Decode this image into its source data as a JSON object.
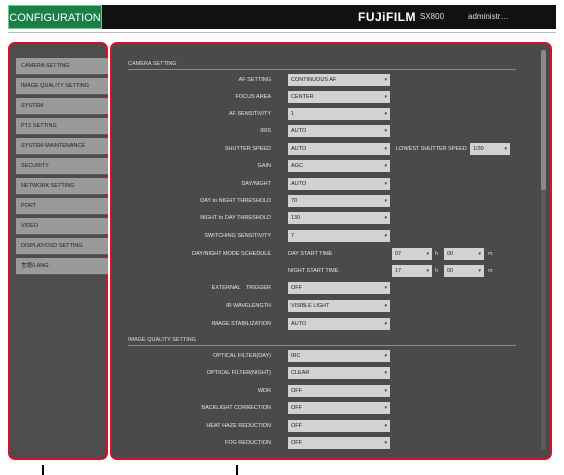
{
  "header": {
    "title": "CONFIGURATION",
    "brand": "FUJiFILM",
    "model": "SX800",
    "user": "administr…"
  },
  "sidebar": {
    "items": [
      {
        "label": "CAMERA SETTING"
      },
      {
        "label": "IMAGE QUALITY SETTING"
      },
      {
        "label": "SYSTEM"
      },
      {
        "label": "PTZ SETTING"
      },
      {
        "label": "SYSTEM MAINTENANCE"
      },
      {
        "label": "SECURITY"
      },
      {
        "label": "NETWORK SETTING"
      },
      {
        "label": "PORT"
      },
      {
        "label": "VIDEO"
      },
      {
        "label": "DISPLAY/OSD SETTING"
      },
      {
        "label": "言語/LANG."
      }
    ]
  },
  "camera_setting": {
    "title": "CAMERA SETTING",
    "af_setting": {
      "label": "AF SETTING",
      "value": "CONTINUOUS AF"
    },
    "focus_area": {
      "label": "FOCUS AREA",
      "value": "CENTER"
    },
    "af_sensitivity": {
      "label": "AF SENSITIVITY",
      "value": "1"
    },
    "iris": {
      "label": "IRIS",
      "value": "AUTO"
    },
    "shutter_speed": {
      "label": "SHUTTER SPEED",
      "value": "AUTO"
    },
    "lowest_shutter": {
      "label": "LOWEST SHUTTER SPEED",
      "value": "1/30"
    },
    "gain": {
      "label": "GAIN",
      "value": "AGC"
    },
    "day_night": {
      "label": "DAY/NIGHT",
      "value": "AUTO"
    },
    "d2n_threshold": {
      "label": "DAY to NIGHT THRESHOLD",
      "value": "70"
    },
    "n2d_threshold": {
      "label": "NIGHT to DAY THRESHOLD",
      "value": "130"
    },
    "switching_sensitivity": {
      "label": "SWITCHING SENSITIVITY",
      "value": "7"
    },
    "schedule": {
      "label": "DAY/NIGHT MODE SCHEDULE",
      "day_label": "DAY START TIME",
      "day_hour": "07",
      "day_min": "00",
      "night_label": "NIGHT START TIME",
      "night_hour": "17",
      "night_min": "00",
      "h_unit": "h",
      "m_unit": "m"
    },
    "external_trigger": {
      "label": "EXTERNAL　TRIGGER",
      "value": "OFF"
    },
    "ir_wavelength": {
      "label": "IR WAVELENGTH",
      "value": "VISIBLE LIGHT"
    },
    "image_stabilization": {
      "label": "IMAGE STABILIZATION",
      "value": "AUTO"
    }
  },
  "image_quality": {
    "title": "IMAGE QUALITY SETTING",
    "optical_filter_day": {
      "label": "OPTICAL FILTER(DAY)",
      "value": "IRC"
    },
    "optical_filter_night": {
      "label": "OPTICAL FILTER(NIGHT)",
      "value": "CLEAR"
    },
    "wdr": {
      "label": "WDR",
      "value": "OFF"
    },
    "backlight": {
      "label": "BACKLIGHT CORRECTION",
      "value": "OFF"
    },
    "heat_haze": {
      "label": "HEAT HAZE REDUCTION",
      "value": "OFF"
    },
    "fog": {
      "label": "FOG REDUCTION",
      "value": "OFF"
    }
  },
  "colors": {
    "accent_green": "#1a7f45",
    "highlight_red": "#d4102b",
    "panel_gray": "#4a4a4a"
  }
}
